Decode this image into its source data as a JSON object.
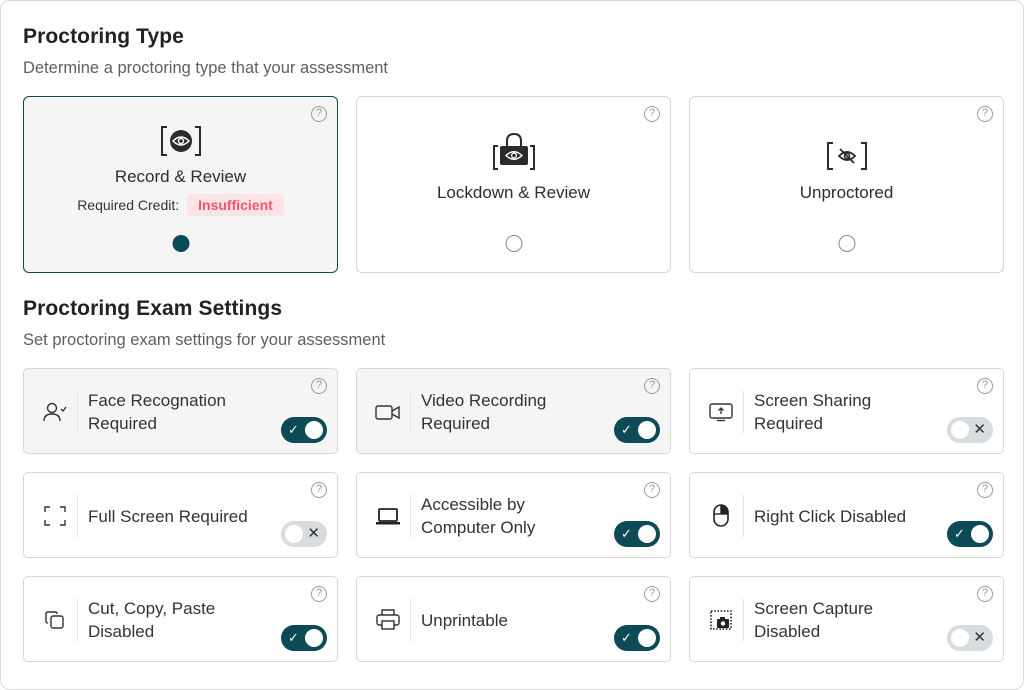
{
  "proctoring_type": {
    "title": "Proctoring Type",
    "subtitle": "Determine a proctoring type that your assessment",
    "options": [
      {
        "label": "Record & Review",
        "icon": "record-eye-icon",
        "selected": true,
        "credit_label": "Required Credit:",
        "credit_status": "Insufficient"
      },
      {
        "label": "Lockdown & Review",
        "icon": "lock-eye-icon",
        "selected": false
      },
      {
        "label": "Unproctored",
        "icon": "eye-off-icon",
        "selected": false
      }
    ],
    "help_glyph": "?"
  },
  "exam_settings": {
    "title": "Proctoring Exam Settings",
    "subtitle": "Set proctoring exam settings for your assessment",
    "items": [
      {
        "label_line1": "Face Recognation",
        "label_line2": "Required",
        "icon": "user-check-icon",
        "enabled": true
      },
      {
        "label_line1": "Video Recording",
        "label_line2": "Required",
        "icon": "video-camera-icon",
        "enabled": true
      },
      {
        "label_line1": "Screen Sharing",
        "label_line2": "Required",
        "icon": "screen-share-icon",
        "enabled": false
      },
      {
        "label_line1": "Full Screen Required",
        "label_line2": "",
        "icon": "fullscreen-icon",
        "enabled": false
      },
      {
        "label_line1": "Accessible by",
        "label_line2": "Computer Only",
        "icon": "laptop-icon",
        "enabled": true
      },
      {
        "label_line1": "Right Click Disabled",
        "label_line2": "",
        "icon": "mouse-icon",
        "enabled": true
      },
      {
        "label_line1": "Cut, Copy, Paste",
        "label_line2": "Disabled",
        "icon": "copy-icon",
        "enabled": true
      },
      {
        "label_line1": "Unprintable",
        "label_line2": "",
        "icon": "printer-icon",
        "enabled": true
      },
      {
        "label_line1": "Screen Capture",
        "label_line2": "Disabled",
        "icon": "screen-capture-icon",
        "enabled": false
      }
    ],
    "toggle_on_glyph": "✓",
    "toggle_off_glyph": "✕"
  },
  "colors": {
    "accent": "#0c4a55",
    "badge_bg": "#fde3e6",
    "badge_text": "#f0566a",
    "toggle_off": "#d8dcdf"
  }
}
